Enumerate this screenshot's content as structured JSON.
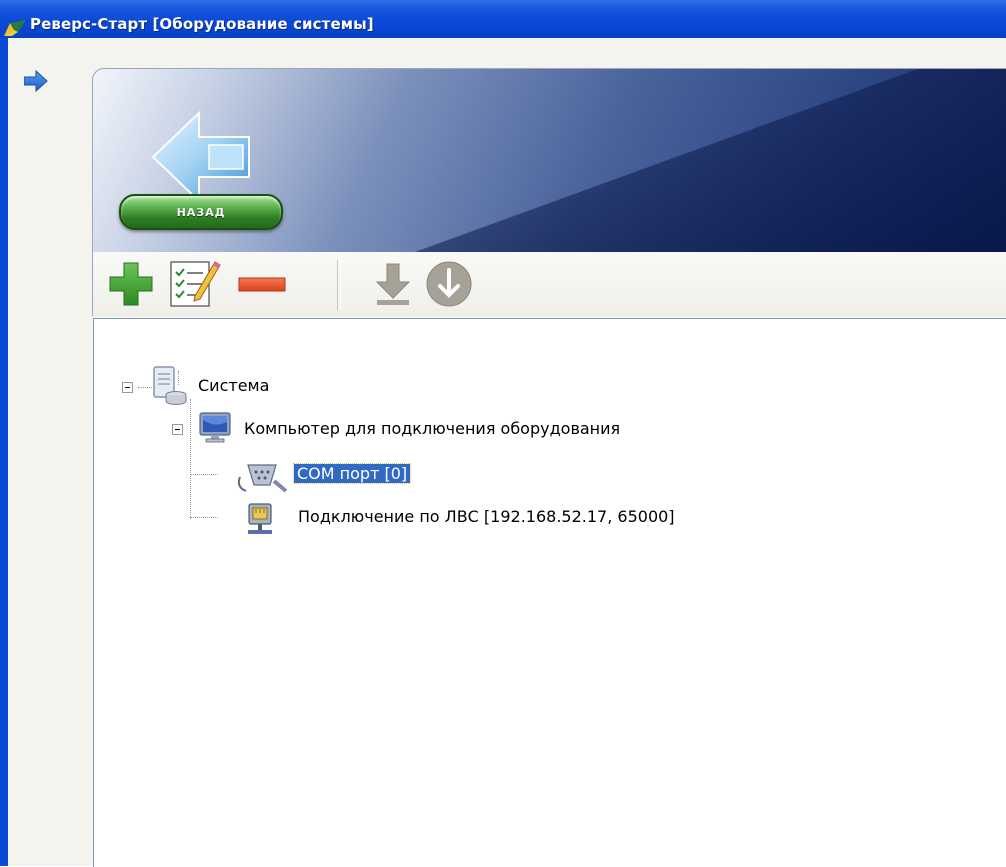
{
  "window": {
    "title": "Реверс-Старт [Оборудование системы]"
  },
  "banner": {
    "back_label": "НАЗАД"
  },
  "toolbar": {
    "buttons": [
      {
        "name": "add-button",
        "icon": "plus-icon"
      },
      {
        "name": "edit-button",
        "icon": "checklist-edit-icon"
      },
      {
        "name": "remove-button",
        "icon": "minus-icon"
      },
      {
        "name": "download-button",
        "icon": "down-arrow-icon"
      },
      {
        "name": "download-circle-button",
        "icon": "circle-down-arrow-icon"
      }
    ]
  },
  "tree": {
    "root": {
      "label": "Система",
      "icon": "database-server-icon",
      "expanded": true,
      "children": [
        {
          "label": "Компьютер для подключения оборудования",
          "icon": "computer-monitor-icon",
          "expanded": true,
          "children": [
            {
              "label": "COM порт  [0]",
              "icon": "serial-connector-icon",
              "selected": true
            },
            {
              "label": "Подключение по ЛВС  [192.168.52.17, 65000]",
              "icon": "network-connection-icon",
              "selected": false
            }
          ]
        }
      ]
    }
  },
  "colors": {
    "titlebar": "#0a49d8",
    "selection": "#316ac5",
    "back_button": "#2e7d24"
  }
}
